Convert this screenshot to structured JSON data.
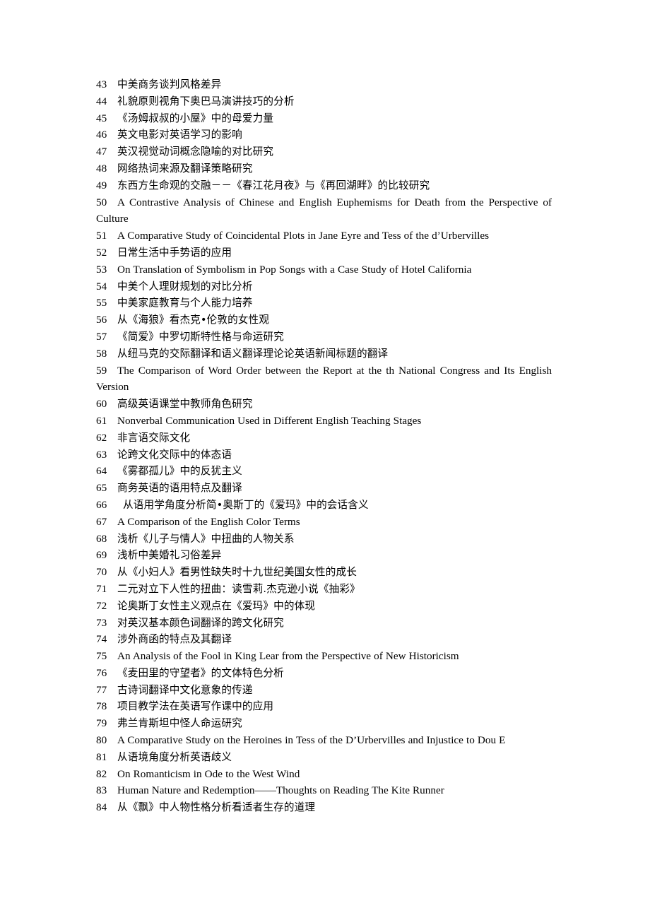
{
  "document": {
    "type": "thesis-topic-list",
    "entries": [
      {
        "number": "43",
        "title": "中美商务谈判风格差异",
        "script": "cjk"
      },
      {
        "number": "44",
        "title": "礼貌原则视角下奥巴马演讲技巧的分析",
        "script": "cjk"
      },
      {
        "number": "45",
        "title": "《汤姆叔叔的小屋》中的母爱力量",
        "script": "cjk"
      },
      {
        "number": "46",
        "title": "英文电影对英语学习的影响",
        "script": "cjk"
      },
      {
        "number": "47",
        "title": "英汉视觉动词概念隐喻的对比研究",
        "script": "cjk"
      },
      {
        "number": "48",
        "title": "网络热词来源及翻译策略研究",
        "script": "cjk"
      },
      {
        "number": "49",
        "title": "东西方生命观的交融－－《春江花月夜》与《再回湖畔》的比较研究",
        "script": "cjk"
      },
      {
        "number": "50",
        "title": "A Contrastive Analysis of Chinese and English Euphemisms for Death from the Perspective of Culture",
        "script": "latin"
      },
      {
        "number": "51",
        "title": "A Comparative Study of Coincidental Plots in Jane Eyre and Tess of the d’Urbervilles",
        "script": "latin"
      },
      {
        "number": "52",
        "title": "日常生活中手势语的应用",
        "script": "cjk"
      },
      {
        "number": "53",
        "title": "On Translation of Symbolism in Pop Songs with a Case Study of Hotel California",
        "script": "latin"
      },
      {
        "number": "54",
        "title": "中美个人理财规划的对比分析",
        "script": "cjk"
      },
      {
        "number": "55",
        "title": "中美家庭教育与个人能力培养",
        "script": "cjk"
      },
      {
        "number": "56",
        "title": "从《海狼》看杰克•伦敦的女性观",
        "script": "cjk"
      },
      {
        "number": "57",
        "title": "《简爱》中罗切斯特性格与命运研究",
        "script": "cjk"
      },
      {
        "number": "58",
        "title": "从纽马克的交际翻译和语义翻译理论论英语新闻标题的翻译",
        "script": "cjk"
      },
      {
        "number": "59",
        "title": "The Comparison of Word Order between the Report at the th National Congress and Its English Version",
        "script": "latin"
      },
      {
        "number": "60",
        "title": "高级英语课堂中教师角色研究",
        "script": "cjk"
      },
      {
        "number": "61",
        "title": "Nonverbal Communication Used in Different English Teaching Stages",
        "script": "latin"
      },
      {
        "number": "62",
        "title": "非言语交际文化",
        "script": "cjk"
      },
      {
        "number": "63",
        "title": "论跨文化交际中的体态语",
        "script": "cjk"
      },
      {
        "number": "64",
        "title": "《雾都孤儿》中的反犹主义",
        "script": "cjk"
      },
      {
        "number": "65",
        "title": "商务英语的语用特点及翻译",
        "script": "cjk"
      },
      {
        "number": "66",
        "title": "从语用学角度分析简•奥斯丁的《爱玛》中的会话含义",
        "script": "cjk",
        "indent": "extra"
      },
      {
        "number": "67",
        "title": "A Comparison of the English Color Terms",
        "script": "latin"
      },
      {
        "number": "68",
        "title": "浅析《儿子与情人》中扭曲的人物关系",
        "script": "cjk"
      },
      {
        "number": "69",
        "title": "浅析中美婚礼习俗差异",
        "script": "cjk"
      },
      {
        "number": "70",
        "title": "从《小妇人》看男性缺失时十九世纪美国女性的成长",
        "script": "cjk"
      },
      {
        "number": "71",
        "title": "二元对立下人性的扭曲：读雪莉.杰克逊小说《抽彩》",
        "script": "cjk"
      },
      {
        "number": "72",
        "title": "论奥斯丁女性主义观点在《爱玛》中的体现",
        "script": "cjk"
      },
      {
        "number": "73",
        "title": "对英汉基本颜色词翻译的跨文化研究",
        "script": "cjk"
      },
      {
        "number": "74",
        "title": "涉外商函的特点及其翻译",
        "script": "cjk"
      },
      {
        "number": "75",
        "title": "An Analysis of the Fool in King Lear from the Perspective of New Historicism",
        "script": "latin"
      },
      {
        "number": "76",
        "title": "《麦田里的守望者》的文体特色分析",
        "script": "cjk"
      },
      {
        "number": "77",
        "title": "古诗词翻译中文化意象的传递",
        "script": "cjk"
      },
      {
        "number": "78",
        "title": "项目教学法在英语写作课中的应用",
        "script": "cjk"
      },
      {
        "number": "79",
        "title": "弗兰肯斯坦中怪人命运研究",
        "script": "cjk"
      },
      {
        "number": "80",
        "title": "A Comparative Study on the Heroines in Tess of the D’Urbervilles and Injustice to Dou E",
        "script": "latin"
      },
      {
        "number": "81",
        "title": "从语境角度分析英语歧义",
        "script": "cjk"
      },
      {
        "number": "82",
        "title": "On Romanticism in Ode to the West Wind",
        "script": "latin"
      },
      {
        "number": "83",
        "title": "Human Nature and Redemption——Thoughts on Reading The Kite Runner",
        "script": "latin"
      },
      {
        "number": "84",
        "title": "从《飘》中人物性格分析看适者生存的道理",
        "script": "cjk"
      }
    ]
  }
}
